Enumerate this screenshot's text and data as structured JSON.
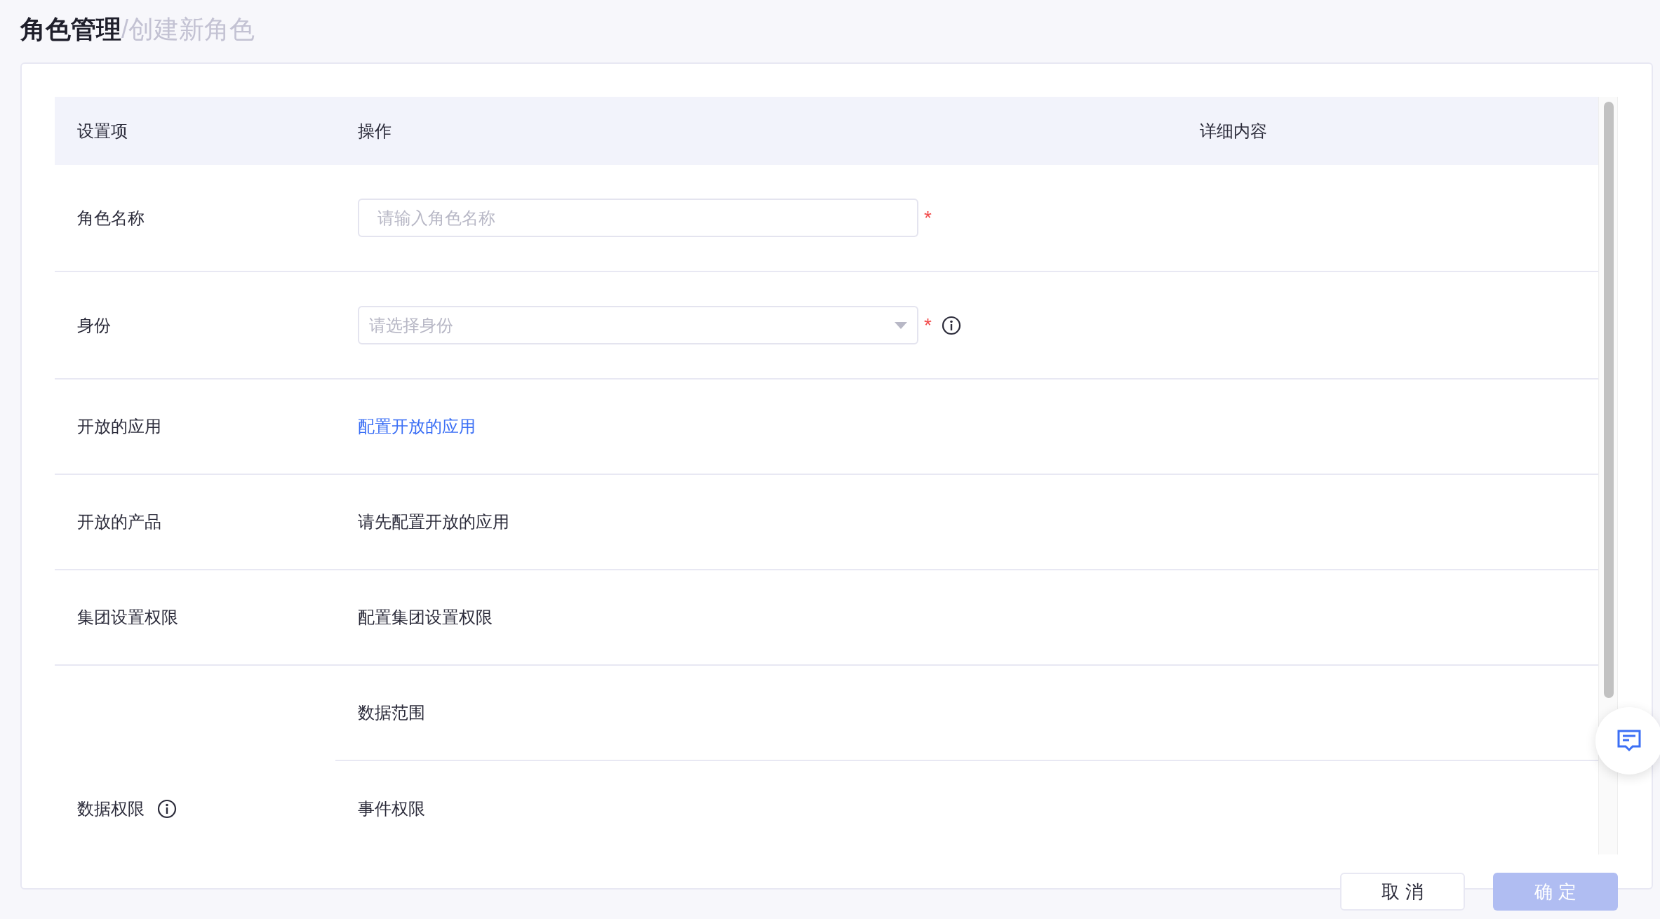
{
  "breadcrumb": {
    "title": "角色管理",
    "separator": "/",
    "current": "创建新角色"
  },
  "table": {
    "columns": [
      "设置项",
      "操作",
      "详细内容"
    ],
    "rows": [
      {
        "label": "角色名称",
        "kind": "input",
        "placeholder": "请输入角色名称",
        "required_mark": "*"
      },
      {
        "label": "身份",
        "kind": "select",
        "placeholder": "请选择身份",
        "required_mark": "*",
        "field_info": true
      },
      {
        "label": "开放的应用",
        "kind": "link",
        "text": "配置开放的应用"
      },
      {
        "label": "开放的产品",
        "kind": "text",
        "text": "请先配置开放的应用"
      },
      {
        "label": "集团设置权限",
        "kind": "text",
        "text": "配置集团设置权限"
      },
      {
        "label": "数据权限",
        "kind": "group",
        "label_info": true,
        "children": [
          {
            "text": "数据范围"
          },
          {
            "text": "事件权限"
          }
        ]
      }
    ]
  },
  "buttons": [
    {
      "label": "取 消",
      "kind": "secondary",
      "disabled": false
    },
    {
      "label": "确 定",
      "kind": "primary",
      "disabled": true
    }
  ]
}
